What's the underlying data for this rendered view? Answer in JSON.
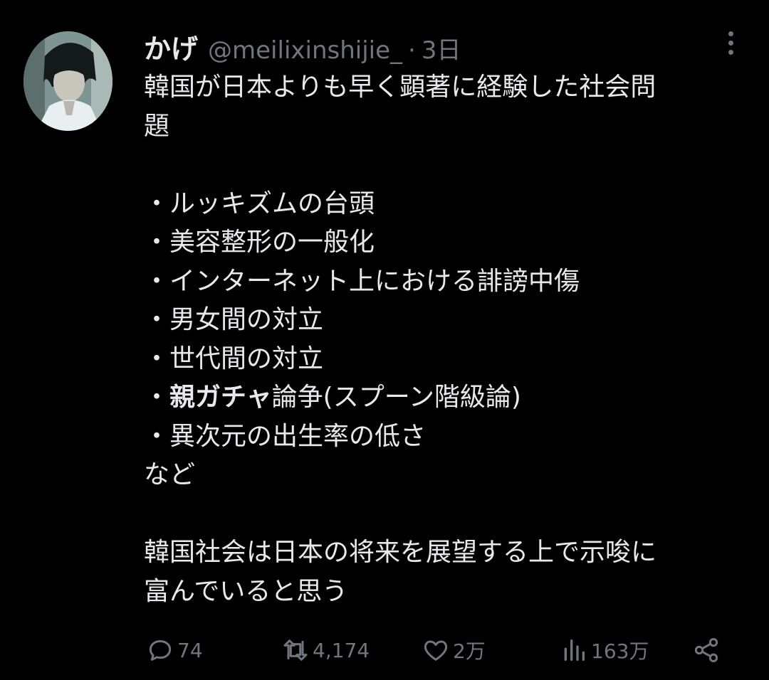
{
  "tweet": {
    "display_name": "かげ",
    "handle": "@meilixinshijie_",
    "separator": "·",
    "time": "3日",
    "text": {
      "line1": "韓国が日本よりも早く顕著に経験した社会問",
      "line2": "題",
      "bullet1": "・ルッキズムの台頭",
      "bullet2": "・美容整形の一般化",
      "bullet3": "・インターネット上における誹謗中傷",
      "bullet4": "・男女間の対立",
      "bullet5": "・世代間の対立",
      "bullet6_prefix": "・",
      "bullet6_bold": "親ガチャ",
      "bullet6_rest": "論争(スプーン階級論)",
      "bullet7": "・異次元の出生率の低さ",
      "etc": "など",
      "closing1": "韓国社会は日本の将来を展望する上で示唆に",
      "closing2": "富んでいると思う"
    }
  },
  "actions": {
    "replies": "74",
    "retweets": "4,174",
    "likes": "2万",
    "views": "163万"
  },
  "icons": {
    "reply": "reply-icon",
    "retweet": "retweet-icon",
    "like": "heart-icon",
    "views": "views-icon",
    "share": "share-icon",
    "more": "more-icon"
  },
  "colors": {
    "background": "#000000",
    "text": "#e7e9ea",
    "muted": "#71767b"
  }
}
